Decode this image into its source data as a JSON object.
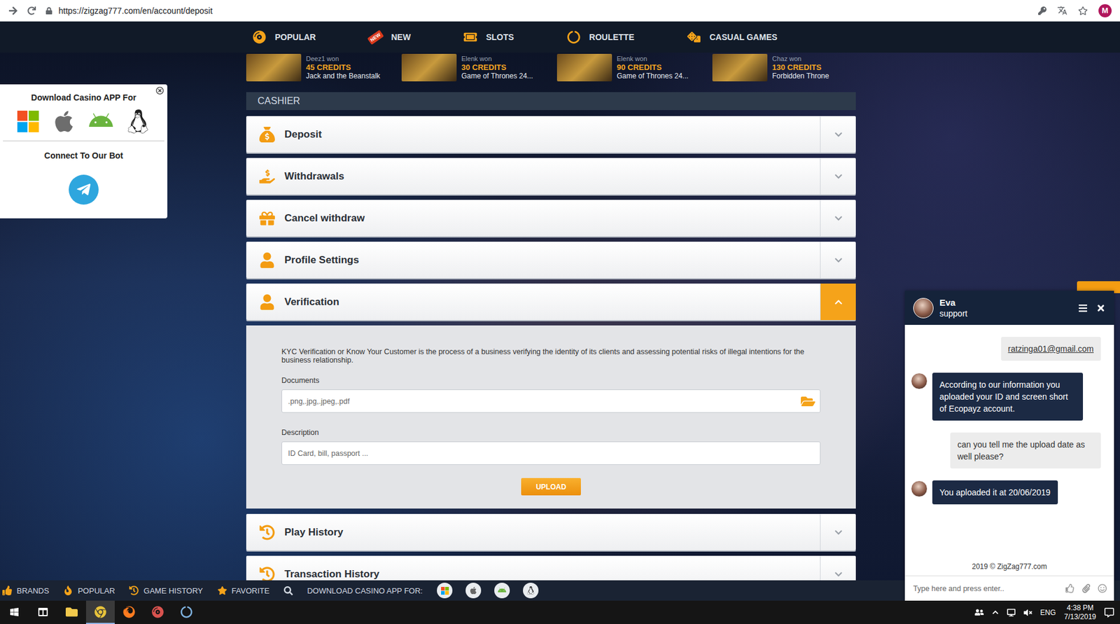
{
  "browser": {
    "url": "https://zigzag777.com/en/account/deposit",
    "avatar": "M"
  },
  "nav": [
    {
      "label": "POPULAR",
      "badge": ""
    },
    {
      "label": "NEW",
      "badge": "NEW"
    },
    {
      "label": "SLOTS",
      "badge": ""
    },
    {
      "label": "ROULETTE",
      "badge": ""
    },
    {
      "label": "CASUAL GAMES",
      "badge": ""
    }
  ],
  "winners": [
    {
      "player": "Deez1 won",
      "credits": "45 CREDITS",
      "game": "Jack and the Beanstalk"
    },
    {
      "player": "Elenk won",
      "credits": "30 CREDITS",
      "game": "Game of Thrones 24..."
    },
    {
      "player": "Elenk won",
      "credits": "90 CREDITS",
      "game": "Game of Thrones 24..."
    },
    {
      "player": "Chaz won",
      "credits": "130 CREDITS",
      "game": "Forbidden Throne"
    }
  ],
  "cashier": {
    "title": "CASHIER",
    "sections": [
      {
        "label": "Deposit",
        "expanded": false
      },
      {
        "label": "Withdrawals",
        "expanded": false
      },
      {
        "label": "Cancel withdraw",
        "expanded": false
      },
      {
        "label": "Profile Settings",
        "expanded": false
      },
      {
        "label": "Verification",
        "expanded": true
      },
      {
        "label": "Play History",
        "expanded": false
      },
      {
        "label": "Transaction History",
        "expanded": false
      }
    ]
  },
  "verification": {
    "intro": "KYC Verification or Know Your Customer is the process of a business verifying the identity of its clients and assessing potential risks of illegal intentions for the business relationship.",
    "documents_label": "Documents",
    "documents_placeholder": ".png,.jpg,.jpeg,.pdf",
    "description_label": "Description",
    "description_placeholder": "ID Card, bill, passport ...",
    "upload_button": "UPLOAD"
  },
  "app_panel": {
    "title": "Download Casino APP For",
    "bot_title": "Connect To Our Bot"
  },
  "chat": {
    "agent": "Eva",
    "role": "support",
    "messages": [
      {
        "kind": "user",
        "text": "ratzinga01@gmail.com",
        "link": true
      },
      {
        "kind": "agent",
        "text": "According to our information you aploaded your ID and screen short of Ecopayz account.",
        "link": false
      },
      {
        "kind": "user",
        "text": "can you tell me the upload date as well please?",
        "link": false
      },
      {
        "kind": "agent",
        "text": "You aploaded it at 20/06/2019",
        "link": false
      }
    ],
    "footer": "2019 © ZigZag777.com",
    "input_placeholder": "Type here and press enter.."
  },
  "bottom_bar": {
    "items": [
      "BRANDS",
      "POPULAR",
      "GAME HISTORY",
      "FAVORITE"
    ],
    "download_label": "DOWNLOAD CASINO APP FOR:"
  },
  "taskbar": {
    "language": "ENG",
    "time": "4:38 PM",
    "date": "7/13/2019"
  }
}
